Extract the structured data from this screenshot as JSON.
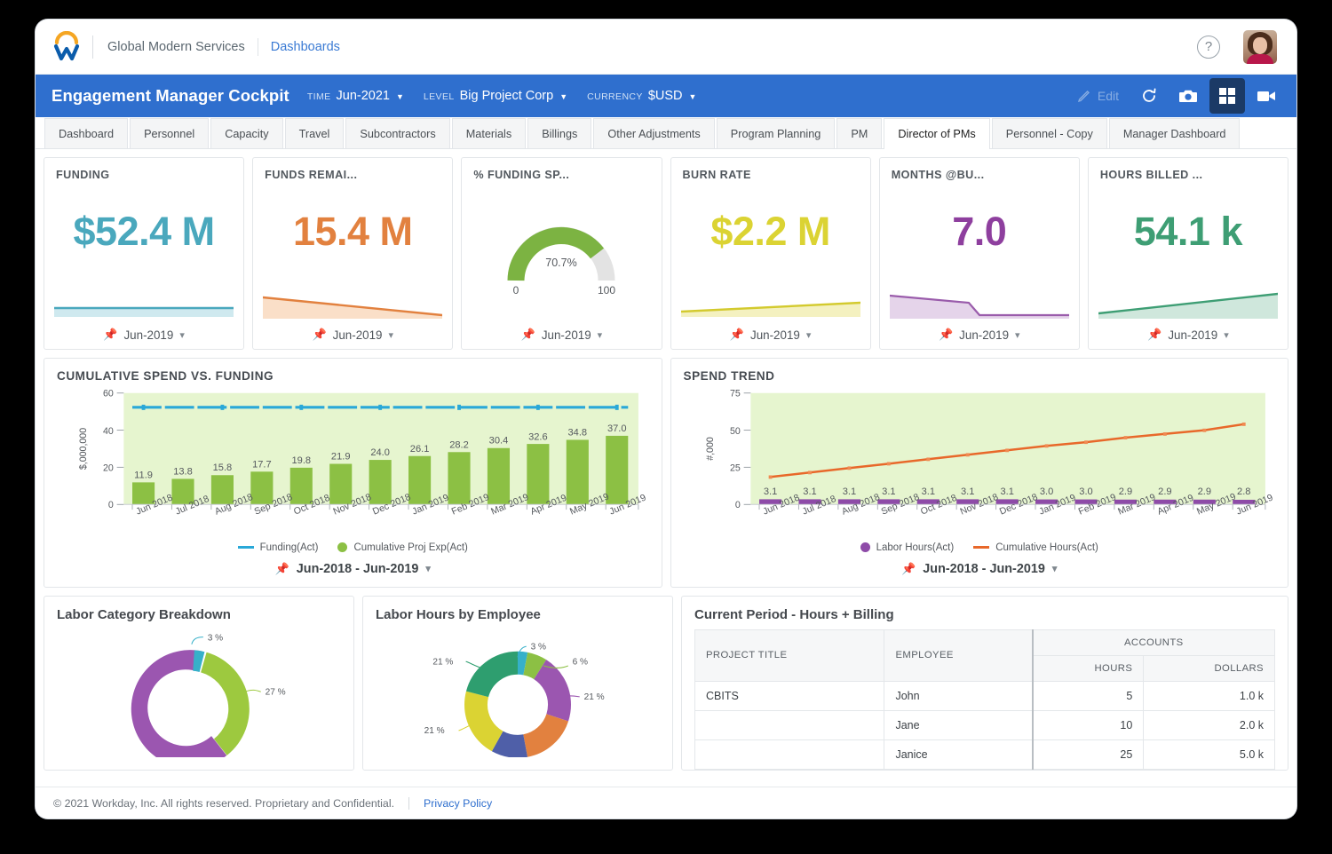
{
  "topbar": {
    "logo_name": "workday-logo",
    "org": "Global Modern Services",
    "breadcrumb": "Dashboards",
    "help_glyph": "?"
  },
  "app_header": {
    "title": "Engagement Manager Cockpit",
    "filters": [
      {
        "label": "TIME",
        "value": "Jun-2021",
        "caret": "▼"
      },
      {
        "label": "LEVEL",
        "value": "Big Project Corp",
        "caret": "▼"
      },
      {
        "label": "CURRENCY",
        "value": "$USD",
        "caret": "▼"
      }
    ],
    "actions": [
      {
        "name": "edit-button",
        "label": "Edit",
        "icon": "pencil-icon",
        "state": "disabled"
      },
      {
        "name": "refresh-button",
        "label": "",
        "icon": "refresh-icon",
        "state": "enabled"
      },
      {
        "name": "snapshot-button",
        "label": "",
        "icon": "camera-icon",
        "state": "enabled"
      },
      {
        "name": "grid-view-button",
        "label": "",
        "icon": "grid-icon",
        "state": "active"
      },
      {
        "name": "video-button",
        "label": "",
        "icon": "video-camera-icon",
        "state": "enabled"
      }
    ],
    "bg_color": "#2f6fce"
  },
  "tabs": [
    {
      "label": "Dashboard",
      "active": false
    },
    {
      "label": "Personnel",
      "active": false
    },
    {
      "label": "Capacity",
      "active": false
    },
    {
      "label": "Travel",
      "active": false
    },
    {
      "label": "Subcontractors",
      "active": false
    },
    {
      "label": "Materials",
      "active": false
    },
    {
      "label": "Billings",
      "active": false
    },
    {
      "label": "Other Adjustments",
      "active": false
    },
    {
      "label": "Program Planning",
      "active": false
    },
    {
      "label": "PM",
      "active": false
    },
    {
      "label": "Director of PMs",
      "active": true
    },
    {
      "label": "Personnel - Copy",
      "active": false
    },
    {
      "label": "Manager Dashboard",
      "active": false
    }
  ],
  "kpis": [
    {
      "title": "FUNDING",
      "value": "$52.4 M",
      "color": "#4aa8bd",
      "period": "Jun-2019",
      "spark": "flat"
    },
    {
      "title": "FUNDS REMAI...",
      "value": "15.4 M",
      "color": "#e2813f",
      "period": "Jun-2019",
      "spark": "down"
    },
    {
      "title": "% FUNDING SP...",
      "value": "70.7%",
      "color": "#7cb342",
      "period": "Jun-2019",
      "spark": "gauge",
      "gauge_min": "0",
      "gauge_max": "100",
      "gauge_pct": 70.7
    },
    {
      "title": "BURN RATE",
      "value": "$2.2 M",
      "color": "#dbd333",
      "period": "Jun-2019",
      "spark": "up"
    },
    {
      "title": "MONTHS @BU...",
      "value": "7.0",
      "color": "#8e3f9e",
      "period": "Jun-2019",
      "spark": "step-down"
    },
    {
      "title": "HOURS BILLED ...",
      "value": "54.1 k",
      "color": "#3e9e74",
      "period": "Jun-2019",
      "spark": "up"
    }
  ],
  "chart_data": [
    {
      "type": "bar",
      "title": "CUMULATIVE SPEND VS. FUNDING",
      "ylabel": "$,000,000",
      "xlabel": "",
      "ylim": [
        0,
        60
      ],
      "yticks": [
        0,
        20,
        40,
        60
      ],
      "grid": false,
      "plot_bg": "#e6f5cf",
      "categories": [
        "Jun 2018",
        "Jul 2018",
        "Aug 2018",
        "Sep 2018",
        "Oct 2018",
        "Nov 2018",
        "Dec 2018",
        "Jan 2019",
        "Feb 2019",
        "Mar 2019",
        "Apr 2019",
        "May 2019",
        "Jun 2019"
      ],
      "series": [
        {
          "name": "Cumulative Proj Exp(Act)",
          "kind": "bar",
          "color": "#8cc044",
          "values": [
            11.9,
            13.8,
            15.8,
            17.7,
            19.8,
            21.9,
            24.0,
            26.1,
            28.2,
            30.4,
            32.6,
            34.8,
            37.0
          ]
        },
        {
          "name": "Funding(Act)",
          "kind": "dashed-line",
          "color": "#29a8d8",
          "values": [
            52.4,
            52.4,
            52.4,
            52.4,
            52.4,
            52.4,
            52.4,
            52.4,
            52.4,
            52.4,
            52.4,
            52.4,
            52.4
          ]
        }
      ],
      "legend": [
        {
          "label": "Funding(Act)",
          "marker": "dashed",
          "color": "#29a8d8"
        },
        {
          "label": "Cumulative Proj Exp(Act)",
          "marker": "dot",
          "color": "#8cc044"
        }
      ],
      "footer_period": "Jun-2018 - Jun-2019"
    },
    {
      "type": "line",
      "title": "SPEND TREND",
      "ylabel": "#,000",
      "xlabel": "",
      "ylim": [
        0,
        75
      ],
      "yticks": [
        0,
        25,
        50,
        75
      ],
      "grid": false,
      "plot_bg": "#e6f5cf",
      "categories": [
        "Jun 2018",
        "Jul 2018",
        "Aug 2018",
        "Sep 2018",
        "Oct 2018",
        "Nov 2018",
        "Dec 2018",
        "Jan 2019",
        "Feb 2019",
        "Mar 2019",
        "Apr 2019",
        "May 2019",
        "Jun 2019"
      ],
      "series": [
        {
          "name": "Labor Hours(Act)",
          "kind": "bar",
          "color": "#8e4ba8",
          "values": [
            3.1,
            3.1,
            3.1,
            3.1,
            3.1,
            3.1,
            3.1,
            3.0,
            3.0,
            2.9,
            2.9,
            2.9,
            2.8
          ]
        },
        {
          "name": "Cumulative Hours(Act)",
          "kind": "line",
          "color": "#e8682a",
          "values": [
            18.5,
            21.5,
            24.5,
            27.5,
            30.5,
            33.5,
            36.5,
            39.5,
            42.0,
            45.0,
            47.5,
            50.0,
            54.1
          ]
        }
      ],
      "legend": [
        {
          "label": "Labor Hours(Act)",
          "marker": "dot",
          "color": "#8e4ba8"
        },
        {
          "label": "Cumulative Hours(Act)",
          "marker": "dashed",
          "color": "#e8682a"
        }
      ],
      "footer_period": "Jun-2018 - Jun-2019"
    },
    {
      "type": "pie",
      "title": "Labor Category Breakdown",
      "labels": [
        "3 %",
        "27 %"
      ],
      "slices": [
        {
          "label": "3 %",
          "value": 3,
          "color": "#36b0c9"
        },
        {
          "label": "27 %",
          "value": 27,
          "color": "#9dc council"
        }
      ]
    },
    {
      "type": "pie",
      "title": "Labor Hours by Employee",
      "labels": [
        "3 %",
        "6 %",
        "21 %",
        "21 %",
        "21 %"
      ],
      "slices": [
        {
          "label": "3 %",
          "value": 3,
          "color": "#36b0c9"
        },
        {
          "label": "6 %",
          "value": 6,
          "color": "#8cc044"
        },
        {
          "label": "21 %",
          "value": 21,
          "color": "#8e4ba8"
        },
        {
          "label": "17 %",
          "value": 17,
          "color": "#e2813f"
        },
        {
          "label": "11 %",
          "value": 11,
          "color": "#4f5fa8"
        },
        {
          "label": "21 %",
          "value": 21,
          "color": "#dbd333"
        },
        {
          "label": "21 %",
          "value": 21,
          "color": "#2e9e6f"
        }
      ]
    }
  ],
  "donut_left": {
    "title": "Labor Category Breakdown",
    "labels": {
      "top": "3 %",
      "right": "27 %"
    }
  },
  "donut_right": {
    "title": "Labor Hours by Employee",
    "labels": {
      "top": "3 %",
      "upper_right": "6 %",
      "right": "21 %",
      "upper_left": "21 %",
      "lower_left": "21 %"
    }
  },
  "table": {
    "title": "Current Period - Hours + Billing",
    "group_header": "ACCOUNTS",
    "columns": [
      "PROJECT TITLE",
      "EMPLOYEE",
      "HOURS",
      "DOLLARS"
    ],
    "rows": [
      {
        "project": "CBITS",
        "employee": "John",
        "hours": "5",
        "dollars": "1.0 k"
      },
      {
        "project": "",
        "employee": "Jane",
        "hours": "10",
        "dollars": "2.0 k"
      },
      {
        "project": "",
        "employee": "Janice",
        "hours": "25",
        "dollars": "5.0 k"
      }
    ]
  },
  "footer": {
    "copyright": "© 2021 Workday, Inc. All rights reserved. Proprietary and Confidential.",
    "privacy_link": "Privacy Policy"
  }
}
